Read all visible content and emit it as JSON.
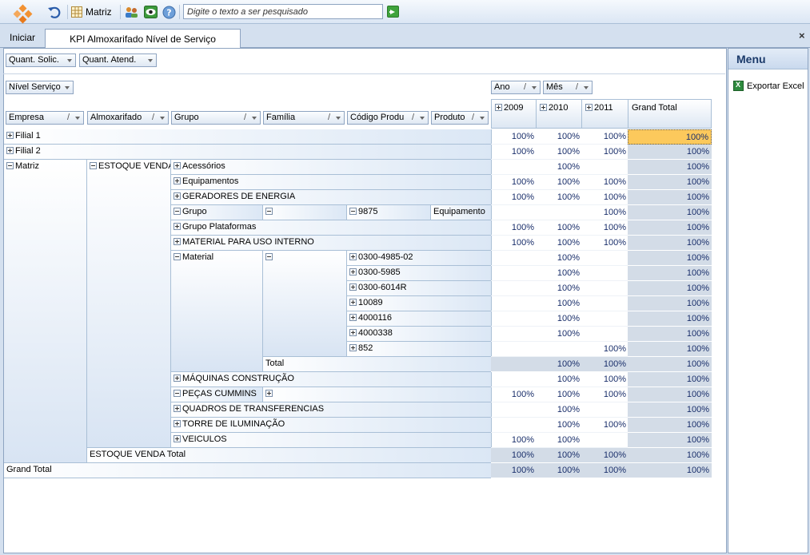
{
  "toolbar": {
    "matriz_label": "Matriz",
    "search_placeholder": "Digite o texto a ser pesquisado"
  },
  "tabs": {
    "home": "Iniciar",
    "active": "KPI Almoxarifado Nível de Serviço"
  },
  "filters": {
    "data_fields": [
      "Quant. Solic.",
      "Quant. Atend."
    ],
    "filter_field": "Nível Serviço",
    "row_fields": [
      "Empresa",
      "Almoxarifado",
      "Grupo",
      "Família",
      "Código Produ",
      "Produto"
    ],
    "col_fields": [
      "Ano",
      "Mês"
    ]
  },
  "columns": [
    "2009",
    "2010",
    "2011",
    "Grand Total"
  ],
  "rows": {
    "filial1": "Filial 1",
    "filial2": "Filial 2",
    "matriz": "Matriz",
    "estoque": "ESTOQUE VENDA",
    "acessorios": "Acessórios",
    "equipamentos": "Equipamentos",
    "geradores": "GERADORES DE ENERGIA",
    "grupo": "Grupo",
    "cod9875": "9875",
    "equipamento": "Equipamento",
    "grupo_plat": "Grupo Plataformas",
    "mat_uso": "MATERIAL PARA USO INTERNO",
    "material": "Material",
    "codes": [
      "0300-4985-02",
      "0300-5985",
      "0300-6014R",
      "10089",
      "4000116",
      "4000338",
      "852"
    ],
    "total": "Total",
    "maquinas": "MÁQUINAS CONSTRUÇÃO",
    "pecas": "PEÇAS CUMMINS",
    "quadros": "QUADROS DE TRANSFERENCIAS",
    "torre": "TORRE DE ILUMINAÇÃO",
    "veiculos": "VEICULOS",
    "estoque_total": "ESTOQUE VENDA Total",
    "grand_total": "Grand Total"
  },
  "values": [
    [
      "100%",
      "100%",
      "100%",
      "100%"
    ],
    [
      "100%",
      "100%",
      "100%",
      "100%"
    ],
    [
      "",
      "100%",
      "",
      "100%"
    ],
    [
      "100%",
      "100%",
      "100%",
      "100%"
    ],
    [
      "100%",
      "100%",
      "100%",
      "100%"
    ],
    [
      "",
      "",
      "100%",
      "100%"
    ],
    [
      "100%",
      "100%",
      "100%",
      "100%"
    ],
    [
      "100%",
      "100%",
      "100%",
      "100%"
    ],
    [
      "",
      "100%",
      "",
      "100%"
    ],
    [
      "",
      "100%",
      "",
      "100%"
    ],
    [
      "",
      "100%",
      "",
      "100%"
    ],
    [
      "",
      "100%",
      "",
      "100%"
    ],
    [
      "",
      "100%",
      "",
      "100%"
    ],
    [
      "",
      "100%",
      "",
      "100%"
    ],
    [
      "",
      "",
      "100%",
      "100%"
    ],
    [
      "",
      "100%",
      "100%",
      "100%"
    ],
    [
      "",
      "100%",
      "100%",
      "100%"
    ],
    [
      "100%",
      "100%",
      "100%",
      "100%"
    ],
    [
      "",
      "100%",
      "",
      "100%"
    ],
    [
      "",
      "100%",
      "100%",
      "100%"
    ],
    [
      "100%",
      "100%",
      "",
      "100%"
    ],
    [
      "100%",
      "100%",
      "100%",
      "100%"
    ],
    [
      "100%",
      "100%",
      "100%",
      "100%"
    ]
  ],
  "menu": {
    "title": "Menu",
    "export": "Exportar Excel"
  },
  "colors": {
    "selected": "#fcc95c",
    "total_bg": "#d3dce7",
    "value_text": "#1a2f6b"
  }
}
